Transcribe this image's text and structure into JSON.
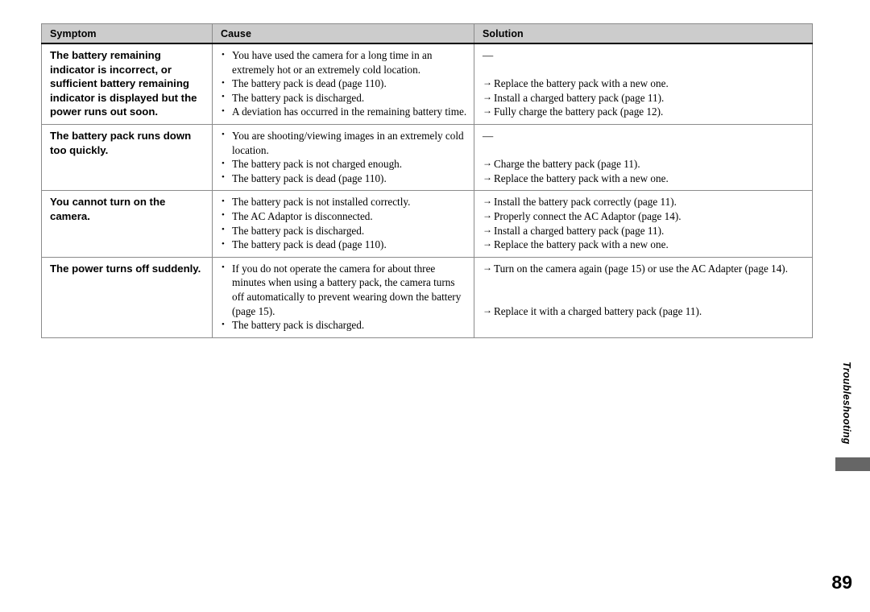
{
  "document": {
    "page_number": "89",
    "side_tab_label": "Troubleshooting"
  },
  "table": {
    "headers": {
      "symptom": "Symptom",
      "cause": "Cause",
      "solution": "Solution"
    },
    "rows": [
      {
        "symptom": "The battery remaining indicator is incorrect, or sufficient battery remaining indicator is displayed but the power runs out soon.",
        "causes": [
          "You have used the camera for a long time in an extremely hot or an extremely cold location.",
          "The battery pack is dead (page 110).",
          "The battery pack is discharged.",
          "A deviation has occurred in the remaining battery time."
        ],
        "solution_dash": "—",
        "solutions": [
          "Replace the battery pack with a new one.",
          "Install a charged battery pack (page 11).",
          "Fully charge the battery pack (page 12)."
        ]
      },
      {
        "symptom": "The battery pack runs down too quickly.",
        "causes": [
          "You are shooting/viewing images in an extremely cold location.",
          "The battery pack is not charged enough.",
          "The battery pack is dead (page 110)."
        ],
        "solution_dash": "—",
        "solutions": [
          "Charge the battery pack (page 11).",
          "Replace the battery pack with a new one."
        ]
      },
      {
        "symptom": "You cannot turn on the camera.",
        "causes": [
          "The battery pack is not installed correctly.",
          "The AC Adaptor is disconnected.",
          "The battery pack is discharged.",
          "The battery pack is dead (page 110)."
        ],
        "solutions": [
          "Install the battery pack correctly (page 11).",
          "Properly connect the AC Adaptor (page 14).",
          "Install a charged battery pack (page 11).",
          "Replace the battery pack with a new one."
        ]
      },
      {
        "symptom": "The power turns off suddenly.",
        "causes": [
          "If you do not operate the camera for about three minutes when using a battery pack, the camera turns off automatically to prevent wearing down the battery (page 15).",
          "The battery pack is discharged."
        ],
        "solutions": [
          "Turn on the camera again (page 15) or use the AC Adapter (page 14).",
          "Replace it with a charged battery pack (page 11)."
        ]
      }
    ]
  },
  "colors": {
    "header_fill": "#cccccc",
    "border": "#8b8b8b",
    "tab_block": "#666666",
    "text": "#000000"
  }
}
